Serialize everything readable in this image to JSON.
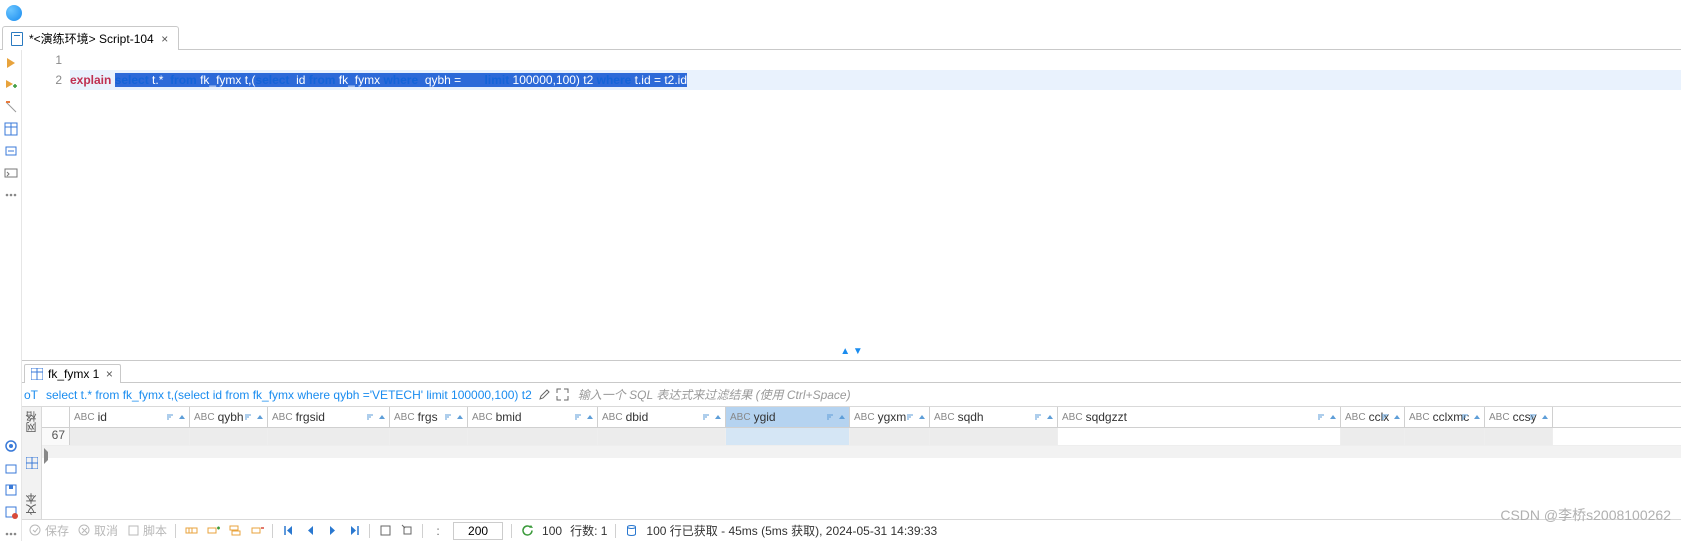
{
  "tabs": {
    "script": {
      "label": "*<演练环境> Script-104"
    }
  },
  "editor": {
    "lines": {
      "l1": "1",
      "l2": "2"
    },
    "line2": {
      "explain": "explain ",
      "select": "select",
      "p1": " t.*  ",
      "from": "from",
      "p2": " fk_fymx t,(",
      "select2": "select",
      "p3": "  id ",
      "from2": "from",
      "p4": " fk_fymx ",
      "where": "where",
      "p5": "  qybh =",
      "blank": "       ",
      "limit": "limit",
      "p6": " 100000,100) t2 ",
      "where2": "where",
      "p7": " t.id = t2.id"
    }
  },
  "results": {
    "tab": "fk_fymx 1",
    "query": "select t.* from fk_fymx t,(select id from fk_fymx where qybh ='VETECH' limit 100000,100) t2",
    "filter_ph": "输入一个 SQL 表达式来过滤结果 (使用 Ctrl+Space)",
    "columns": [
      {
        "t": "ABC",
        "n": "id"
      },
      {
        "t": "ABC",
        "n": "qybh"
      },
      {
        "t": "ABC",
        "n": "frgsid"
      },
      {
        "t": "ABC",
        "n": "frgs"
      },
      {
        "t": "ABC",
        "n": "bmid"
      },
      {
        "t": "ABC",
        "n": "dbid"
      },
      {
        "t": "ABC",
        "n": "ygid"
      },
      {
        "t": "ABC",
        "n": "ygxm"
      },
      {
        "t": "ABC",
        "n": "sqdh"
      },
      {
        "t": "ABC",
        "n": "sqdgzzt"
      },
      {
        "t": "ABC",
        "n": "cclx"
      },
      {
        "t": "ABC",
        "n": "cclxmc"
      },
      {
        "t": "ABC",
        "n": "ccsy"
      }
    ],
    "row_num": "67",
    "selected_col": 6,
    "grid_side": "网格",
    "grid_side2": "文本"
  },
  "footer": {
    "save": "保存",
    "cancel": "取消",
    "script": "脚本",
    "fetch_size": "200",
    "rows_count": "100",
    "rows_label": "行数: 1",
    "status": "100 行已获取 - 45ms (5ms 获取), 2024-05-31 14:39:33"
  },
  "watermark": "CSDN @李桥s2008100262"
}
